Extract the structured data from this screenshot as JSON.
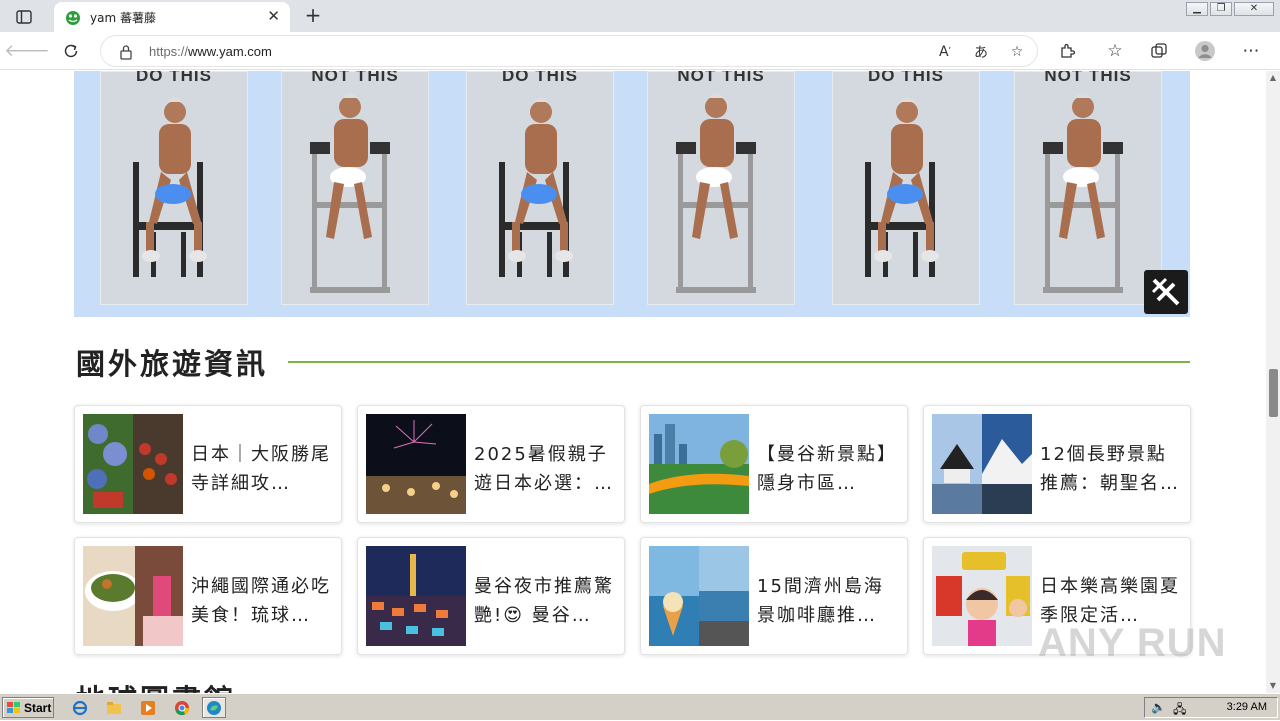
{
  "browser": {
    "tab_title": "yam 蕃薯藤",
    "tab_close": "✕",
    "new_tab": "+",
    "url_proto": "https://",
    "url_host": "www.yam.com"
  },
  "ad": {
    "captions": [
      "DO THIS",
      "NOT THIS",
      "DO THIS",
      "NOT THIS",
      "DO THIS",
      "NOT THIS"
    ]
  },
  "section": {
    "title": "國外旅遊資訊",
    "cards": [
      {
        "title": "日本｜大阪勝尾寺詳細攻…"
      },
      {
        "title": "2025暑假親子遊日本必選：…"
      },
      {
        "title": "【曼谷新景點】隱身市區…"
      },
      {
        "title": "12個長野景點推薦：朝聖名…"
      },
      {
        "title": "沖繩國際通必吃美食！琉球…"
      },
      {
        "title": "曼谷夜市推薦驚艷!😍 曼谷…"
      },
      {
        "title": "15間濟州島海景咖啡廳推…"
      },
      {
        "title": "日本樂高樂園夏季限定活…"
      }
    ]
  },
  "section2": {
    "title": "地球圖書館"
  },
  "watermark": "ANY RUN",
  "taskbar": {
    "start_label": "Start",
    "clock": "3:29 AM"
  }
}
